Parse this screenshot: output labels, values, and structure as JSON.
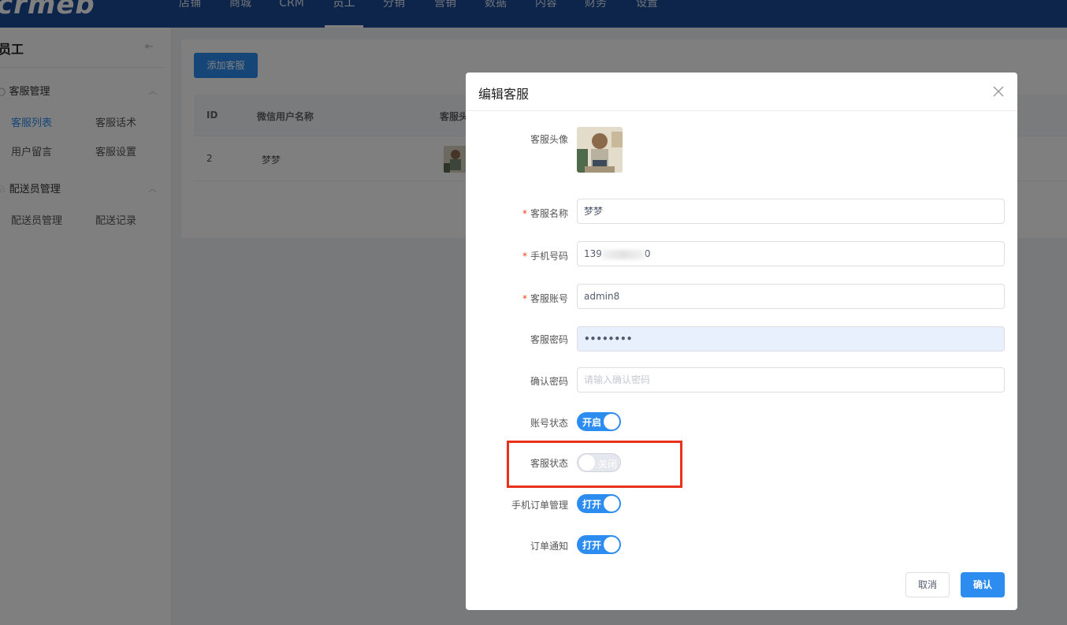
{
  "brand": {
    "logo_text": "crmeb"
  },
  "topnav": {
    "items": [
      {
        "label": "店铺"
      },
      {
        "label": "商城"
      },
      {
        "label": "CRM"
      },
      {
        "label": "员工"
      },
      {
        "label": "分销"
      },
      {
        "label": "营销"
      },
      {
        "label": "数据"
      },
      {
        "label": "内容"
      },
      {
        "label": "财务"
      },
      {
        "label": "设置"
      }
    ],
    "active": "员工"
  },
  "sidebar": {
    "title": "员工",
    "groups": [
      {
        "label": "客服管理",
        "links": [
          "客服列表",
          "客服话术",
          "用户留言",
          "客服设置"
        ]
      },
      {
        "label": "配送员管理",
        "links": [
          "配送员管理",
          "配送记录"
        ]
      }
    ],
    "active_link": "客服列表"
  },
  "main": {
    "add_button": "添加客服",
    "table": {
      "headers": [
        "ID",
        "微信用户名称",
        "客服头"
      ],
      "rows": [
        {
          "id": "2",
          "name": "梦梦"
        }
      ]
    }
  },
  "modal": {
    "title": "编辑客服",
    "fields": {
      "avatar_label": "客服头像",
      "name_label": "客服名称",
      "name_value": "梦梦",
      "phone_label": "手机号码",
      "phone_prefix": "139",
      "phone_suffix": "0",
      "account_label": "客服账号",
      "account_value": "admin8",
      "password_label": "客服密码",
      "password_value": "••••••••",
      "confirm_label": "确认密码",
      "confirm_placeholder": "请输入确认密码"
    },
    "switches": {
      "account_status_label": "账号状态",
      "account_status_text": "开启",
      "account_status_on": true,
      "service_status_label": "客服状态",
      "service_status_text": "关闭",
      "service_status_on": false,
      "mobile_order_label": "手机订单管理",
      "mobile_order_text": "打开",
      "mobile_order_on": true,
      "order_notice_label": "订单通知",
      "order_notice_text": "打开",
      "order_notice_on": true
    },
    "buttons": {
      "cancel": "取消",
      "confirm": "确认"
    }
  },
  "colors": {
    "primary": "#2d8cf0",
    "nav": "#1a4a96",
    "required": "#ed4014",
    "highlight": "#e8321c"
  }
}
